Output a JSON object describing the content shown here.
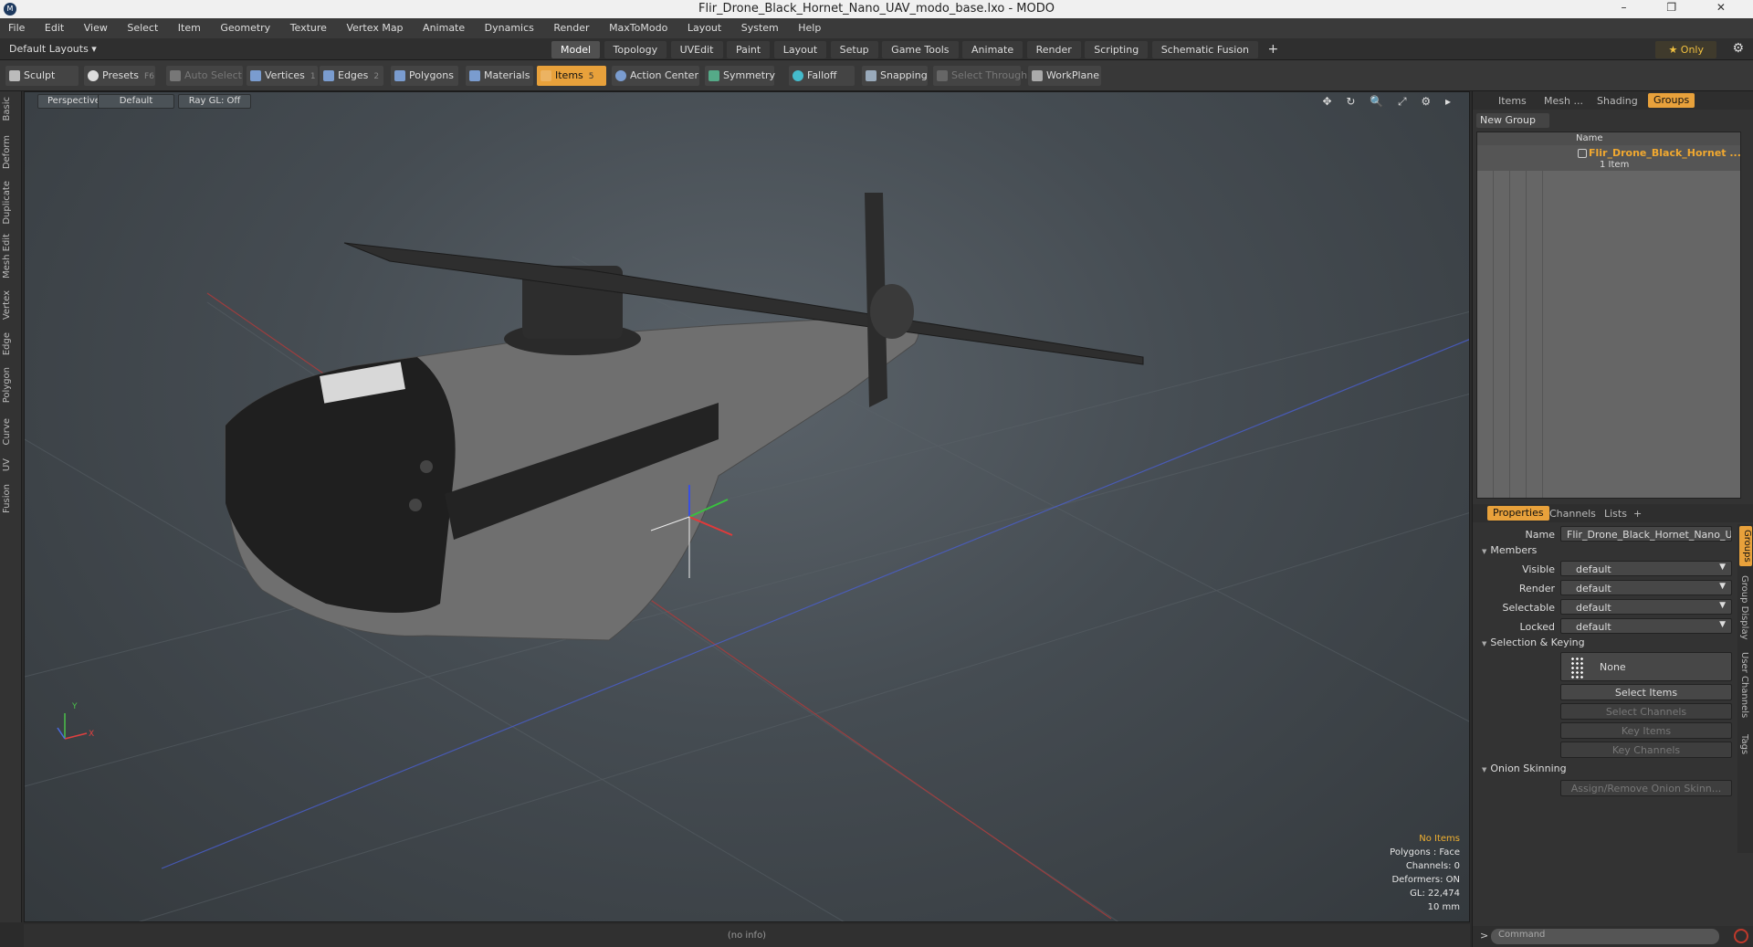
{
  "window": {
    "title": "Flir_Drone_Black_Hornet_Nano_UAV_modo_base.lxo - MODO",
    "controls": "–  ❐  ✕"
  },
  "menu": [
    "File",
    "Edit",
    "View",
    "Select",
    "Item",
    "Geometry",
    "Texture",
    "Vertex Map",
    "Animate",
    "Dynamics",
    "Render",
    "MaxToModo",
    "Layout",
    "System",
    "Help"
  ],
  "layouts": {
    "selector": "Default Layouts ▾",
    "tabs": [
      "Model",
      "Topology",
      "UVEdit",
      "Paint",
      "Layout",
      "Setup",
      "Game Tools",
      "Animate",
      "Render",
      "Scripting",
      "Schematic Fusion"
    ],
    "active_tab": "Model",
    "plus": "+",
    "only": "★  Only",
    "gear": "⚙"
  },
  "toolbar": {
    "sculpt": "Sculpt",
    "presets": "Presets",
    "presets_key": "F6",
    "auto_select": "Auto Select",
    "vertices": "Vertices",
    "vertices_key": "1",
    "edges": "Edges",
    "edges_key": "2",
    "polygons": "Polygons",
    "materials": "Materials",
    "items": "Items",
    "items_key": "5",
    "action_center": "Action Center",
    "symmetry": "Symmetry",
    "falloff": "Falloff",
    "snapping": "Snapping",
    "select_through": "Select Through",
    "workplane": "WorkPlane"
  },
  "left_tabs": [
    "Basic",
    "Deform",
    "Duplicate",
    "Mesh Edit",
    "Vertex",
    "Edge",
    "Polygon",
    "Curve",
    "UV",
    "Fusion"
  ],
  "viewport": {
    "view": "Perspective",
    "shading": "Default",
    "raygl": "Ray GL: Off",
    "icons": "✥ ↻ 🔍 ⤢ ⚙ ▸",
    "stats": {
      "no_items": "No Items",
      "polygons": "Polygons : Face",
      "channels": "Channels: 0",
      "deformers": "Deformers: ON",
      "gl": "GL: 22,474",
      "scale": "10 mm"
    },
    "axis_y": "Y",
    "axis_x": "X"
  },
  "status": "(no info)",
  "right_panel": {
    "tabs": [
      "Items",
      "Mesh ...",
      "Shading",
      "Groups"
    ],
    "active_tab": "Groups",
    "new_group": "New Group",
    "col_name": "Name",
    "group_name": "Flir_Drone_Black_Hornet ...",
    "group_count": "1 Item"
  },
  "properties": {
    "tabs": [
      "Properties",
      "Channels",
      "Lists",
      "+"
    ],
    "active_tab": "Properties",
    "name_label": "Name",
    "name_value": "Flir_Drone_Black_Hornet_Nano_U",
    "members": "Members",
    "visible_label": "Visible",
    "visible_value": "default",
    "render_label": "Render",
    "render_value": "default",
    "selectable_label": "Selectable",
    "selectable_value": "default",
    "locked_label": "Locked",
    "locked_value": "default",
    "selection_keying": "Selection & Keying",
    "none": "None",
    "select_items": "Select Items",
    "select_channels": "Select Channels",
    "key_items": "Key Items",
    "key_channels": "Key Channels",
    "onion": "Onion Skinning",
    "assign_onion": "Assign/Remove Onion Skinn...",
    "side_tabs": [
      "Groups",
      "Group Display",
      "User Channels",
      "Tags"
    ]
  },
  "command": {
    "placeholder": "Command",
    "chevron": ">"
  }
}
